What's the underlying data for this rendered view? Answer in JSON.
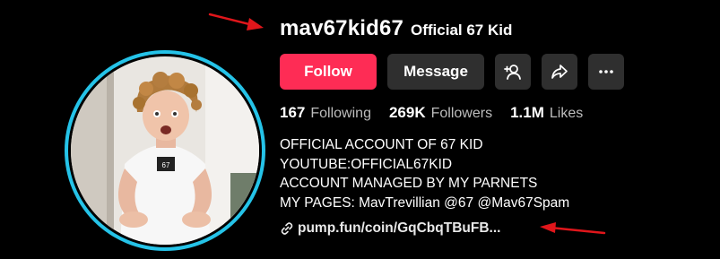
{
  "profile": {
    "username": "mav67kid67",
    "nickname": "Official 67 Kid",
    "shirt_text": "67"
  },
  "actions": {
    "follow_label": "Follow",
    "message_label": "Message",
    "add_friend_icon": "add-user-icon",
    "share_icon": "share-icon",
    "more_icon": "more-icon"
  },
  "stats": [
    {
      "value": "167",
      "label": "Following"
    },
    {
      "value": "269K",
      "label": "Followers"
    },
    {
      "value": "1.1M",
      "label": "Likes"
    }
  ],
  "bio": [
    "OFFICIAL ACCOUNT OF 67 KID",
    "YOUTUBE:OFFICIAL67KID",
    "ACCOUNT MANAGED BY MY PARNETS",
    "MY PAGES: MavTrevillian @67 @Mav67Spam"
  ],
  "link": {
    "text": "pump.fun/coin/GqCbqTBuFB...",
    "icon": "link-icon"
  },
  "colors": {
    "background": "#000000",
    "follow": "#fe2c55",
    "secondary_button": "#2f2f2f",
    "avatar_ring": "#25c3e8",
    "annotation_arrow": "#e0161b"
  }
}
